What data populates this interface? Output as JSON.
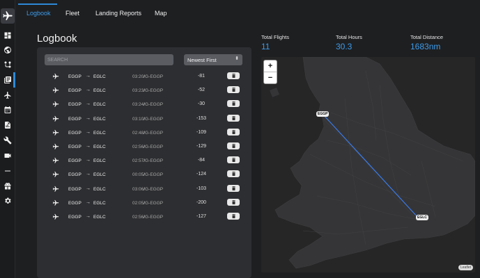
{
  "tabs": [
    {
      "label": "Logbook",
      "active": true
    },
    {
      "label": "Fleet",
      "active": false
    },
    {
      "label": "Landing Reports",
      "active": false
    },
    {
      "label": "Map",
      "active": false
    }
  ],
  "sidebar": {
    "items": [
      "dashboard-icon",
      "globe-icon",
      "routes-icon",
      "logbook-icon",
      "airplane-icon",
      "calendar-icon",
      "report-icon",
      "tools-icon",
      "camera-icon",
      "minus-icon",
      "gift-icon",
      "settings-icon"
    ],
    "active_index": 3
  },
  "page_title": "Logbook",
  "search": {
    "placeholder": "SEARCH",
    "value": ""
  },
  "sort": {
    "selected": "Newest First"
  },
  "flights": [
    {
      "dep": "EGGP",
      "arr": "EGLC",
      "time": "03:20",
      "reg": "G-EGGP",
      "rate": "-81"
    },
    {
      "dep": "EGGP",
      "arr": "EGLC",
      "time": "03:23",
      "reg": "G-EGGP",
      "rate": "-52"
    },
    {
      "dep": "EGGP",
      "arr": "EGLC",
      "time": "03:24",
      "reg": "G-EGGP",
      "rate": "-30"
    },
    {
      "dep": "EGGP",
      "arr": "EGLC",
      "time": "03:10",
      "reg": "G-EGGP",
      "rate": "-153"
    },
    {
      "dep": "EGGP",
      "arr": "EGLC",
      "time": "02:48",
      "reg": "G-EGGP",
      "rate": "-109"
    },
    {
      "dep": "EGGP",
      "arr": "EGLC",
      "time": "02:56",
      "reg": "G-EGGP",
      "rate": "-129"
    },
    {
      "dep": "EGGP",
      "arr": "EGLC",
      "time": "02:57",
      "reg": "G-EGGP",
      "rate": "-84"
    },
    {
      "dep": "EGGP",
      "arr": "EGLC",
      "time": "00:05",
      "reg": "G-EGGP",
      "rate": "-124"
    },
    {
      "dep": "EGGP",
      "arr": "EGLC",
      "time": "03:06",
      "reg": "G-EGGP",
      "rate": "-103"
    },
    {
      "dep": "EGGP",
      "arr": "EGLC",
      "time": "02:05",
      "reg": "G-EGGP",
      "rate": "-200"
    },
    {
      "dep": "EGGP",
      "arr": "EGLC",
      "time": "02:56",
      "reg": "G-EGGP",
      "rate": "-127"
    }
  ],
  "stats": {
    "flights_label": "Total Flights",
    "flights_value": "11",
    "hours_label": "Total Hours",
    "hours_value": "30.3",
    "distance_label": "Total Distance",
    "distance_value": "1683nm"
  },
  "map": {
    "zoom_in": "+",
    "zoom_out": "−",
    "attribution": "Leaflet",
    "origin_label": "EGGP",
    "destination_label": "EGLC",
    "route_color": "#3b7be8"
  },
  "colors": {
    "accent": "#2f8ad8",
    "stat_value": "#3d9be9"
  }
}
